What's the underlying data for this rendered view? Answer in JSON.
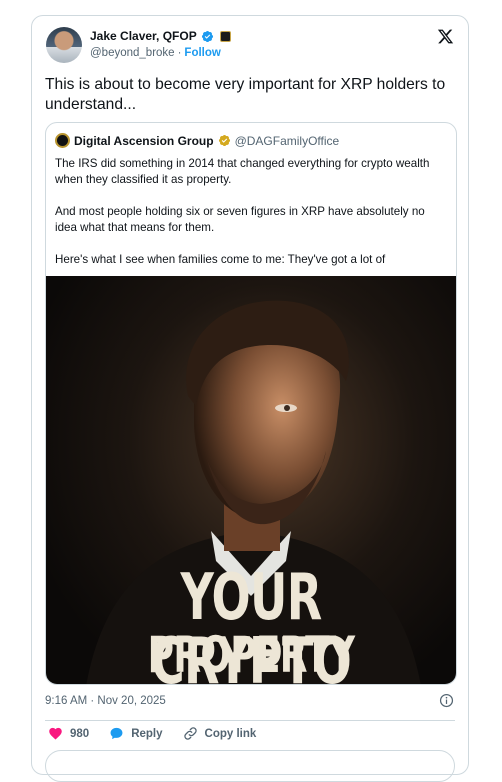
{
  "author": {
    "display_name": "Jake Claver, QFOP",
    "handle": "@beyond_broke",
    "separator": "·",
    "follow_label": "Follow"
  },
  "tweet": {
    "text": "This is about to become very important for XRP holders to understand..."
  },
  "quoted": {
    "display_name": "Digital Ascension Group",
    "handle": "@DAGFamilyOffice",
    "paragraphs": [
      "The IRS did something in 2014 that changed everything for crypto wealth when they classified it as property.",
      "And most people holding six or seven figures in XRP have absolutely no idea what that means for them.",
      "Here's what I see when families come to me: They've got a lot of"
    ],
    "image_headline_line1": "YOUR CRYPTO",
    "image_headline_line2": "PROPERTY RIGHTS"
  },
  "meta": {
    "timestamp": "9:16 AM · Nov 20, 2025"
  },
  "actions": {
    "like_count": "980",
    "reply_label": "Reply",
    "copy_link_label": "Copy link"
  },
  "colors": {
    "accent": "#1d9bf0",
    "like": "#f91880",
    "gold": "#d4a91f",
    "text": "#0f1419",
    "muted": "#536471",
    "border": "#cfd9de"
  },
  "icons": [
    "verified-badge-icon",
    "affiliate-badge-icon",
    "x-logo-icon",
    "gold-verified-icon",
    "info-icon",
    "heart-icon",
    "reply-icon",
    "link-icon"
  ]
}
